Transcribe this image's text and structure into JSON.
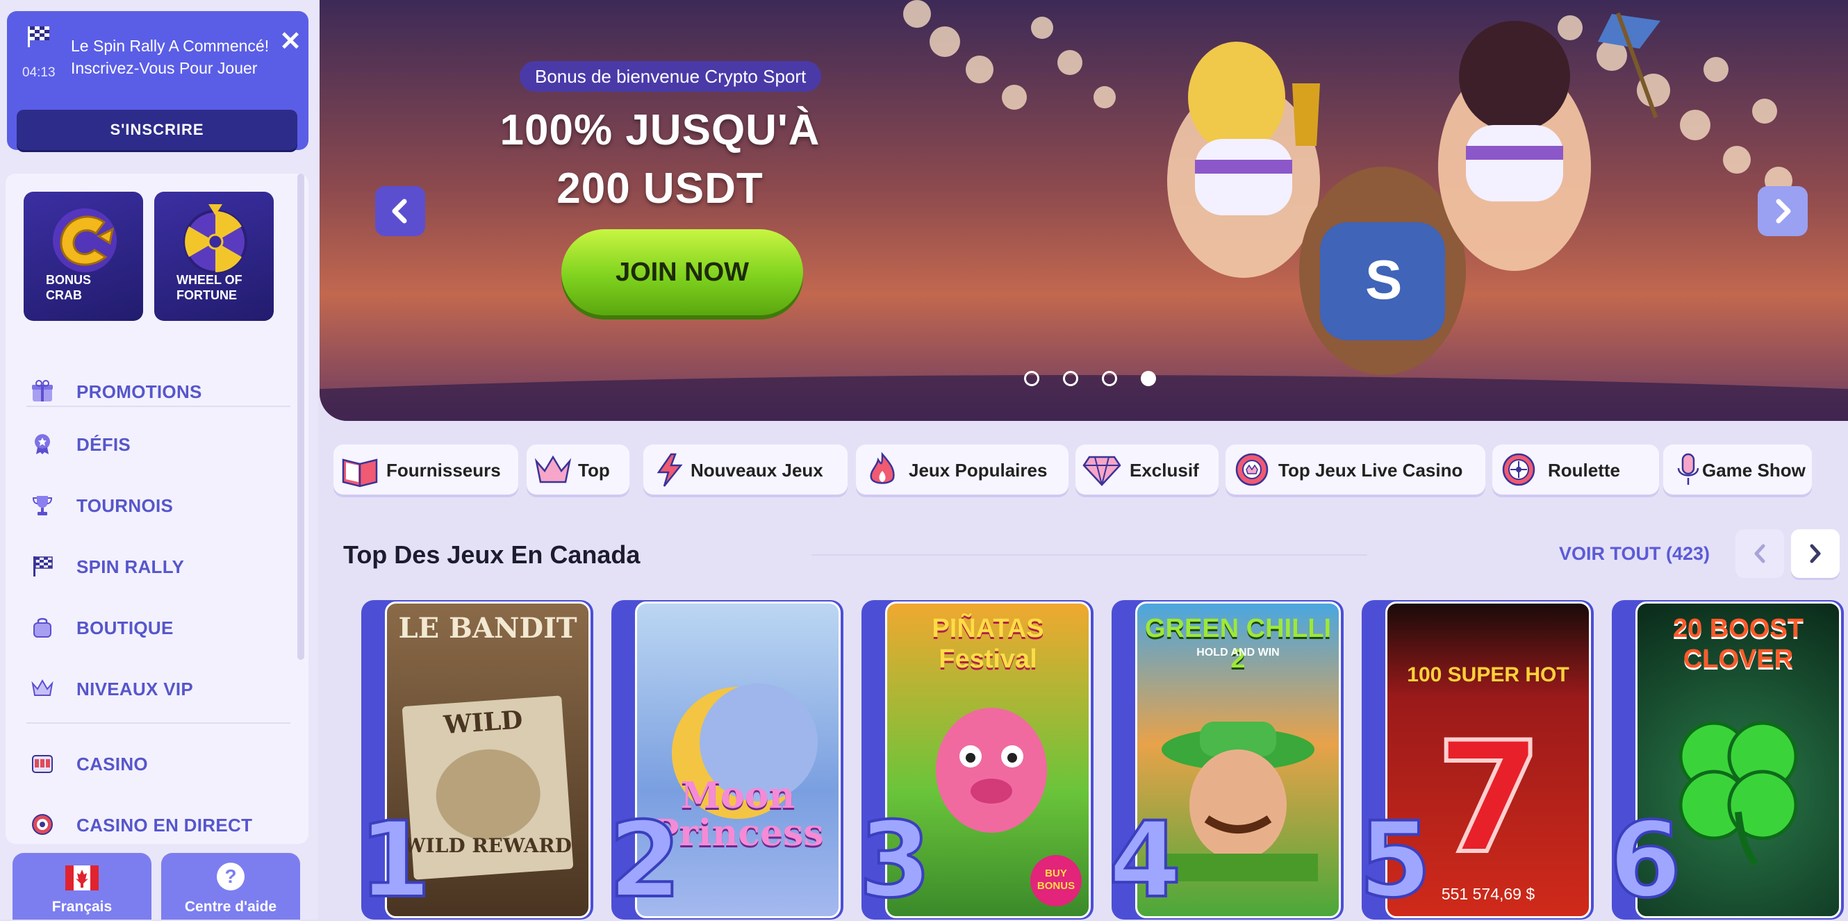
{
  "notification": {
    "time": "04:13",
    "message": "Le Spin Rally A Commencé! Inscrivez-Vous Pour Jouer",
    "button_label": "S'INSCRIRE"
  },
  "sidebar": {
    "tiles": [
      {
        "label": "BONUS CRAB",
        "icon": "crab-claw-icon"
      },
      {
        "label": "WHEEL OF FORTUNE",
        "icon": "wheel-icon"
      }
    ],
    "items": [
      {
        "label": "PROMOTIONS",
        "icon": "gift-icon"
      },
      {
        "label": "DÉFIS",
        "icon": "medal-icon"
      },
      {
        "label": "TOURNOIS",
        "icon": "trophy-icon"
      },
      {
        "label": "SPIN RALLY",
        "icon": "checkered-flag-icon"
      },
      {
        "label": "BOUTIQUE",
        "icon": "shopping-bag-icon"
      },
      {
        "label": "NIVEAUX VIP",
        "icon": "crown-icon"
      },
      {
        "label": "CASINO",
        "icon": "slot-machine-icon"
      },
      {
        "label": "CASINO EN DIRECT",
        "icon": "roulette-chip-icon"
      }
    ],
    "language_label": "Français",
    "help_label": "Centre d'aide",
    "help_icon_glyph": "?"
  },
  "banner": {
    "badge": "Bonus de bienvenue Crypto Sport",
    "headline": "100% JUSQU'À 200 USDT",
    "cta": "JOIN NOW",
    "slides_total": 4,
    "active_slide": 4
  },
  "categories": [
    {
      "label": "Fournisseurs",
      "icon": "book-icon"
    },
    {
      "label": "Top",
      "icon": "crown-icon"
    },
    {
      "label": "Nouveaux Jeux",
      "icon": "lightning-icon"
    },
    {
      "label": "Jeux Populaires",
      "icon": "flame-icon"
    },
    {
      "label": "Exclusif",
      "icon": "diamond-icon"
    },
    {
      "label": "Top Jeux Live Casino",
      "icon": "casino-chip-icon"
    },
    {
      "label": "Roulette",
      "icon": "roulette-icon"
    },
    {
      "label": "Game Show",
      "icon": "microphone-icon"
    }
  ],
  "section": {
    "title": "Top Des Jeux En Canada",
    "see_all": "VOIR TOUT (423)"
  },
  "games": [
    {
      "rank": "1",
      "title": "LE BANDIT",
      "subtitle": "WILD REWARD"
    },
    {
      "rank": "2",
      "title": "Moon Princess",
      "subtitle": ""
    },
    {
      "rank": "3",
      "title": "PIÑATAS Festival",
      "subtitle": "BUY BONUS"
    },
    {
      "rank": "4",
      "title": "GREEN CHILLI 2",
      "subtitle": "HOLD AND WIN"
    },
    {
      "rank": "5",
      "title": "100 SUPER HOT",
      "subtitle": "551 574,69 $"
    },
    {
      "rank": "6",
      "title": "20 BOOST CLOVER",
      "subtitle": ""
    }
  ],
  "colors": {
    "accent": "#5b5bd6",
    "notification_bg": "#5a5ee6",
    "cta_green": "#7fd21e",
    "sidebar_text": "#5656cc"
  }
}
